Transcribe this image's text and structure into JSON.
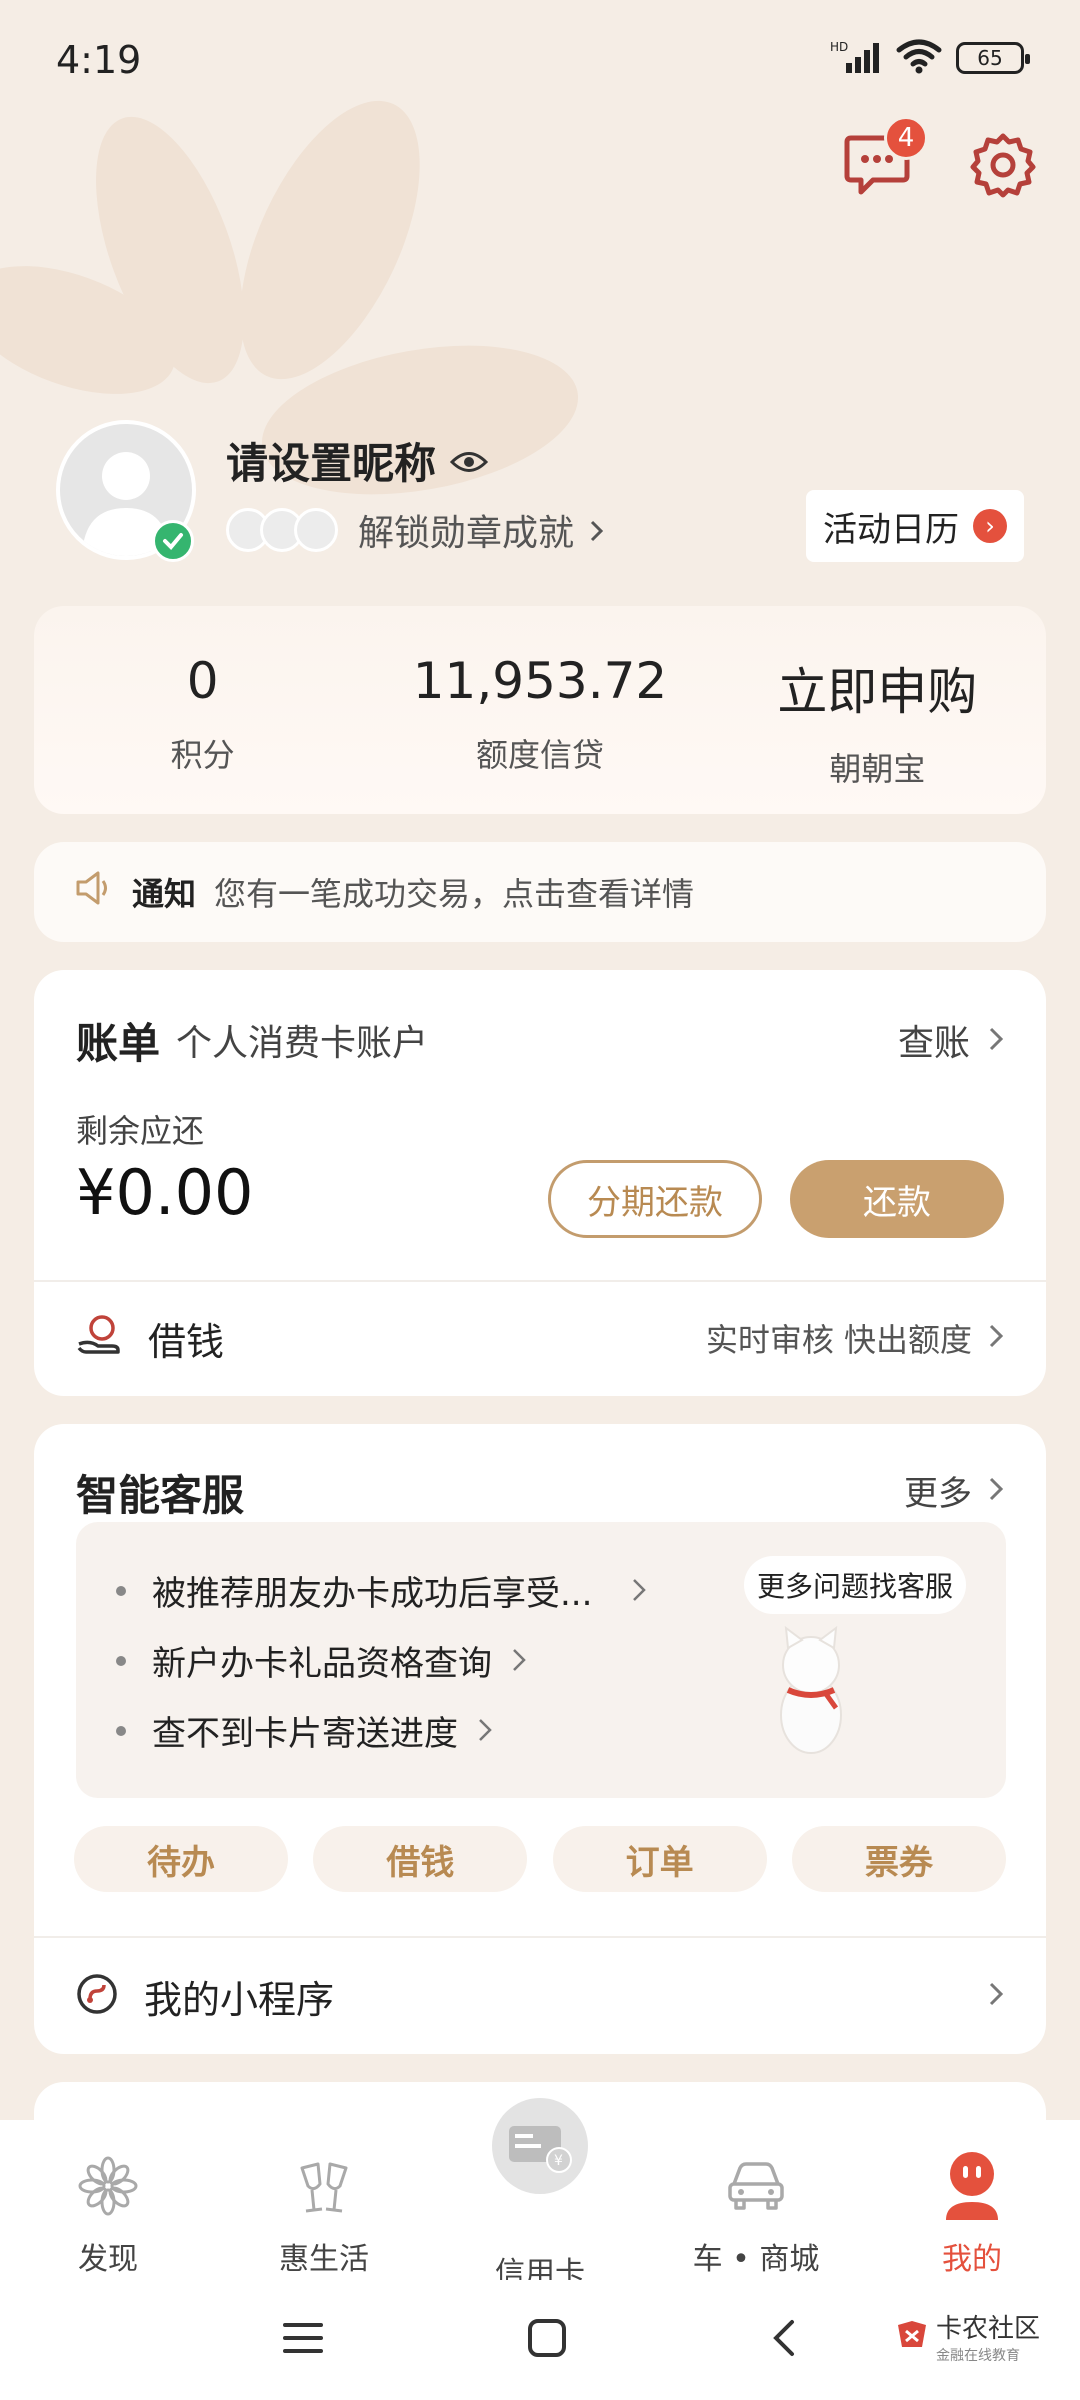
{
  "status_bar": {
    "time": "4:19",
    "network": "HD",
    "battery": "65"
  },
  "header": {
    "message_badge": "4"
  },
  "profile": {
    "nickname": "请设置昵称",
    "medal_text": "解锁勋章成就",
    "activity_button": "活动日历",
    "activity_arrow": "›"
  },
  "stats": [
    {
      "value": "0",
      "label": "积分"
    },
    {
      "value": "11,953.72",
      "label": "额度信贷"
    },
    {
      "value": "立即申购",
      "label": "朝朝宝"
    }
  ],
  "notice": {
    "title": "通知",
    "text": "您有一笔成功交易，点击查看详情"
  },
  "bill": {
    "title": "账单",
    "subtitle": "个人消费卡账户",
    "check_link": "查账",
    "remain_label": "剩余应还",
    "remain_amount": "¥0.00",
    "installment_button": "分期还款",
    "repay_button": "还款",
    "borrow_label": "借钱",
    "borrow_hint": "实时审核 快出额度"
  },
  "service": {
    "title": "智能客服",
    "more_link": "更多",
    "faqs": [
      "被推荐朋友办卡成功后享受...",
      "新户办卡礼品资格查询",
      "查不到卡片寄送进度"
    ],
    "bubble": "更多问题找客服",
    "quick_buttons": [
      "待办",
      "借钱",
      "订单",
      "票券"
    ],
    "mini_program": "我的小程序"
  },
  "tabbar": [
    {
      "label": "发现",
      "icon": "flower-icon"
    },
    {
      "label": "惠生活",
      "icon": "cheers-icon"
    },
    {
      "label": "信用卡",
      "icon": "credit-card-icon"
    },
    {
      "label": "车 • 商城",
      "icon": "car-icon"
    },
    {
      "label": "我的",
      "icon": "profile-icon"
    }
  ],
  "watermark": {
    "title": "卡农社区",
    "subtitle": "金融在线教育"
  },
  "colors": {
    "accent_gold": "#c9a06f",
    "badge_red": "#e4513d",
    "verified_green": "#35b56f",
    "background": "#f5ede5"
  }
}
